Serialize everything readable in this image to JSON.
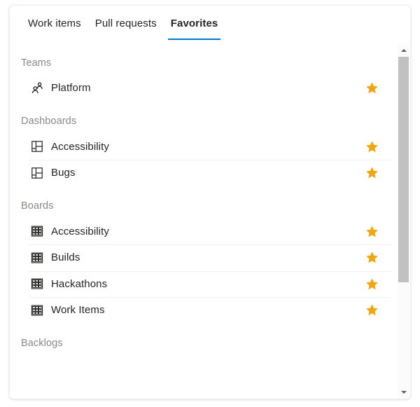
{
  "tabs": [
    {
      "label": "Work items",
      "selected": false
    },
    {
      "label": "Pull requests",
      "selected": false
    },
    {
      "label": "Favorites",
      "selected": true
    }
  ],
  "sections": [
    {
      "header": "Teams",
      "icon": "people-icon",
      "rows": [
        {
          "label": "Platform",
          "favorited": true
        }
      ]
    },
    {
      "header": "Dashboards",
      "icon": "dashboard-icon",
      "rows": [
        {
          "label": "Accessibility",
          "favorited": true
        },
        {
          "label": "Bugs",
          "favorited": true
        }
      ]
    },
    {
      "header": "Boards",
      "icon": "board-icon",
      "rows": [
        {
          "label": "Accessibility",
          "favorited": true
        },
        {
          "label": "Builds",
          "favorited": true
        },
        {
          "label": "Hackathons",
          "favorited": true
        },
        {
          "label": "Work Items",
          "favorited": true
        }
      ]
    },
    {
      "header": "Backlogs",
      "icon": "backlog-icon",
      "rows": []
    }
  ],
  "scrollbar": {
    "up_label": "Scroll up",
    "down_label": "Scroll down"
  },
  "colors": {
    "accent": "#0078d4",
    "star": "#f2a60c",
    "text": "#252423",
    "muted": "#8a8886",
    "divider": "#f0f0f0",
    "scroll_thumb": "#c1c1c1"
  }
}
